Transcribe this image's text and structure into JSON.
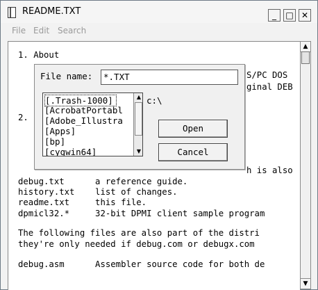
{
  "window": {
    "title": "README.TXT",
    "menus": [
      "File",
      "Edit",
      "Search"
    ],
    "controls": {
      "minimize": "_",
      "maximize": "□",
      "close": "✕"
    }
  },
  "document": {
    "lines": [
      "1. About",
      "",
      "S/PC DOS",
      "ginal DEB",
      "2.",
      "",
      "",
      "",
      "h is also",
      "debug.txt      a reference guide.",
      "history.txt    list of changes.",
      "readme.txt     this file.",
      "dpmicl32.*     32-bit DPMI client sample program",
      "",
      "The following files are also part of the distri",
      "they're only needed if debug.com or debugx.com",
      "",
      "debug.asm      Assembler source code for both de"
    ]
  },
  "dialog": {
    "filename_label": "File name:",
    "filename_value": "*.TXT",
    "current_dir": "c:\\",
    "directory_list": [
      "[.Trash-1000]",
      "[AcrobatPortabl",
      "[Adobe_Illustra",
      "[Apps]",
      "[bp]",
      "[cygwin64]"
    ],
    "open_label": "Open",
    "cancel_label": "Cancel"
  }
}
